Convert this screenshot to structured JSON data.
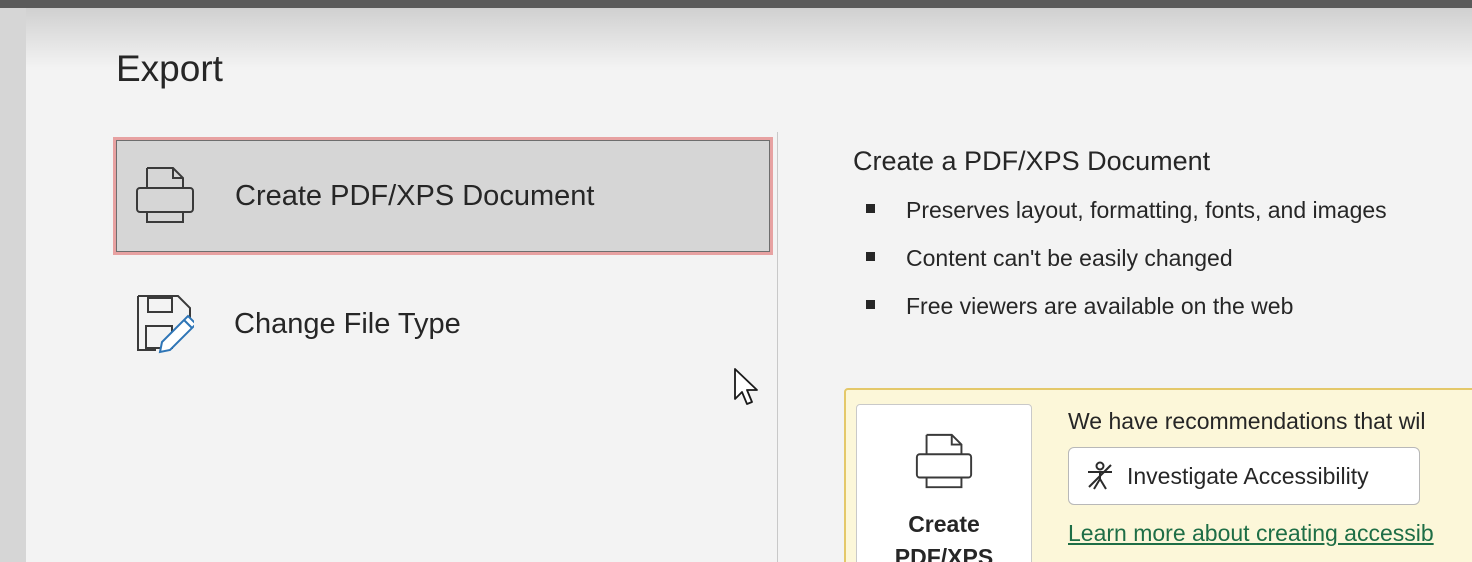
{
  "window": {
    "title": "Export"
  },
  "options": [
    {
      "label": "Create PDF/XPS Document",
      "icon": "pdf-document-icon",
      "selected": true
    },
    {
      "label": "Change File Type",
      "icon": "change-file-type-icon",
      "selected": false
    }
  ],
  "detail": {
    "heading": "Create a PDF/XPS Document",
    "bullets": [
      "Preserves layout, formatting, fonts, and images",
      "Content can't be easily changed",
      "Free viewers are available on the web"
    ]
  },
  "recommendation": {
    "big_button_line1": "Create",
    "big_button_line2": "PDF/XPS",
    "text": "We have recommendations that wil",
    "accessibility_button": "Investigate Accessibility",
    "accessibility_icon": "accessibility-icon",
    "learn_more": "Learn more about creating accessib"
  },
  "colors": {
    "selected_background": "#d6d6d6",
    "selected_outline": "#e7a1a1",
    "recommend_background": "#fcf7d9",
    "recommend_border": "#e4c869",
    "link": "#1e6e46"
  }
}
